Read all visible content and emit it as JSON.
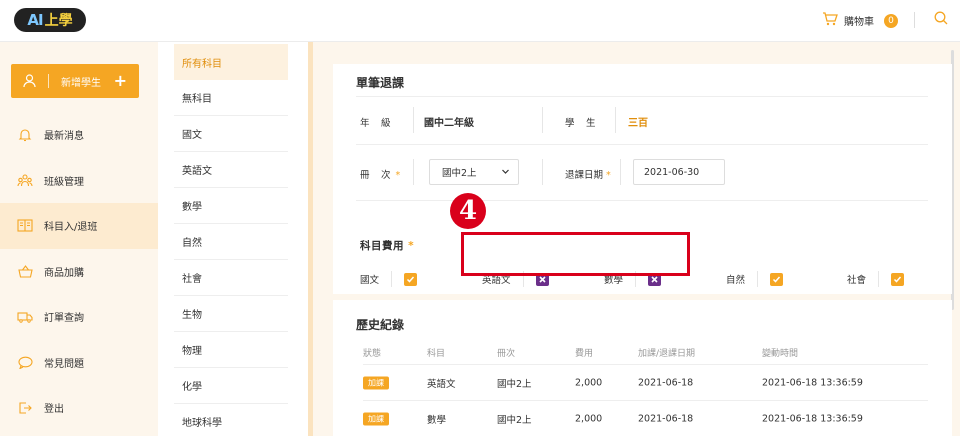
{
  "header": {
    "logo_ai": "AI",
    "logo_cn": "上學",
    "cart_label": "購物車",
    "cart_count": "0"
  },
  "sidebar": {
    "add_student": "新增學生",
    "items": [
      {
        "label": "最新消息",
        "icon": "bell-icon"
      },
      {
        "label": "班級管理",
        "icon": "class-group-icon"
      },
      {
        "label": "科目入/退班",
        "icon": "book-open-icon"
      },
      {
        "label": "商品加購",
        "icon": "basket-icon"
      },
      {
        "label": "訂單查詢",
        "icon": "truck-icon"
      },
      {
        "label": "常見問題",
        "icon": "chat-bubble-icon"
      },
      {
        "label": "登出",
        "icon": "logout-icon"
      }
    ],
    "active_index": 2
  },
  "subjects": {
    "items": [
      "所有科目",
      "無科目",
      "國文",
      "英語文",
      "數學",
      "自然",
      "社會",
      "生物",
      "物理",
      "化學",
      "地球科學"
    ],
    "active_index": 0
  },
  "form": {
    "title": "單筆退課",
    "grade_label": "年　級",
    "grade_value": "國中二年級",
    "student_label": "學　生",
    "student_value": "三百",
    "volume_label": "冊　次",
    "volume_value": "國中2上",
    "date_label": "退課日期",
    "date_value": "2021-06-30",
    "fee_title": "科目費用",
    "fees": [
      {
        "label": "國文",
        "checked": true
      },
      {
        "label": "英語文",
        "checked": false
      },
      {
        "label": "數學",
        "checked": false
      },
      {
        "label": "自然",
        "checked": true
      },
      {
        "label": "社會",
        "checked": true
      }
    ]
  },
  "annotation": {
    "step": "4"
  },
  "history": {
    "title": "歷史紀錄",
    "columns": [
      "狀態",
      "科目",
      "冊次",
      "費用",
      "加課/退課日期",
      "變動時間"
    ],
    "rows": [
      {
        "status": "加課",
        "subject": "英語文",
        "volume": "國中2上",
        "fee": "2,000",
        "date": "2021-06-18",
        "time": "2021-06-18 13:36:59"
      },
      {
        "status": "加課",
        "subject": "數學",
        "volume": "國中2上",
        "fee": "2,000",
        "date": "2021-06-18",
        "time": "2021-06-18 13:36:59"
      }
    ]
  },
  "colors": {
    "accent": "#f5a623",
    "unchecked": "#6b2f8a",
    "highlight": "#d9001b"
  }
}
